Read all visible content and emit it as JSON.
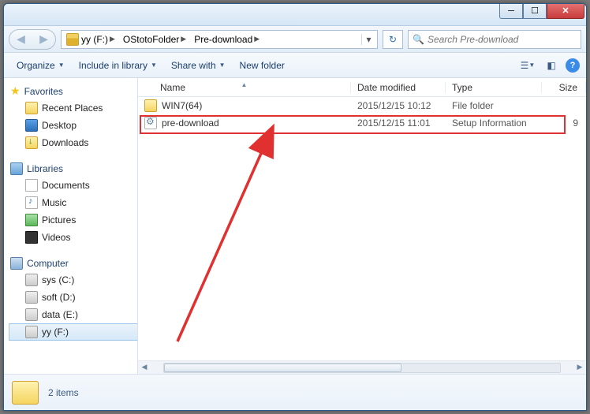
{
  "breadcrumb": {
    "drive": "yy (F:)",
    "seg1": "OStotoFolder",
    "seg2": "Pre-download"
  },
  "search": {
    "placeholder": "Search Pre-download"
  },
  "toolbar": {
    "organize": "Organize",
    "include": "Include in library",
    "share": "Share with",
    "newfolder": "New folder"
  },
  "nav": {
    "favorites": "Favorites",
    "recent": "Recent Places",
    "desktop": "Desktop",
    "downloads": "Downloads",
    "libraries": "Libraries",
    "documents": "Documents",
    "music": "Music",
    "pictures": "Pictures",
    "videos": "Videos",
    "computer": "Computer",
    "sys": "sys (C:)",
    "soft": "soft (D:)",
    "data": "data (E:)",
    "yy": "yy (F:)"
  },
  "columns": {
    "name": "Name",
    "date": "Date modified",
    "type": "Type",
    "size": "Size"
  },
  "files": {
    "f0": {
      "name": "WIN7(64)",
      "date": "2015/12/15 10:12",
      "type": "File folder",
      "size": ""
    },
    "f1": {
      "name": "pre-download",
      "date": "2015/12/15 11:01",
      "type": "Setup Information",
      "size": "9"
    }
  },
  "status": {
    "count": "2 items"
  }
}
